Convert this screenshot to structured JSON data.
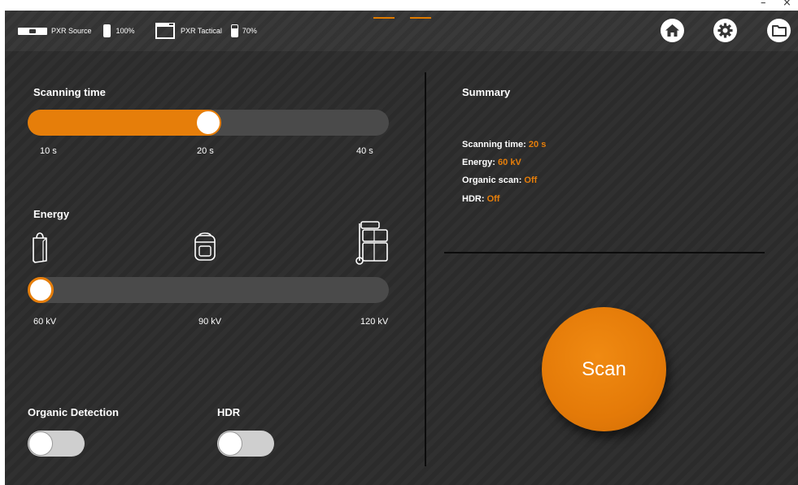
{
  "window": {
    "minimize_glyph": "–",
    "close_glyph": "×"
  },
  "topbar": {
    "devices": [
      {
        "icon": "xray-source-icon",
        "name": "PXR Source",
        "battery_icon": "battery-icon",
        "battery": "100%"
      },
      {
        "icon": "tactical-panel-icon",
        "name": "PXR Tactical",
        "battery_icon": "battery-icon",
        "battery": "70%"
      }
    ],
    "nav": [
      {
        "icon": "home-icon"
      },
      {
        "icon": "gear-icon"
      },
      {
        "icon": "folder-icon"
      }
    ]
  },
  "scanning_time": {
    "label": "Scanning time",
    "ticks": [
      "10 s",
      "20 s",
      "40 s"
    ],
    "selected": "20 s",
    "selected_fraction": 0.5
  },
  "energy": {
    "label": "Energy",
    "icons": [
      "bag-icon",
      "backpack-icon",
      "luggage-cart-icon"
    ],
    "ticks": [
      "60 kV",
      "90 kV",
      "120 kV"
    ],
    "selected": "60 kV",
    "selected_fraction": 0.0
  },
  "toggles": {
    "organic": {
      "label": "Organic Detection",
      "state": "Off"
    },
    "hdr": {
      "label": "HDR",
      "state": "Off"
    }
  },
  "summary": {
    "title": "Summary",
    "lines": [
      {
        "key": "Scanning time:",
        "value": "20 s"
      },
      {
        "key": "Energy:",
        "value": "60 kV"
      },
      {
        "key": "Organic scan:",
        "value": "Off"
      },
      {
        "key": "HDR:",
        "value": "Off"
      }
    ]
  },
  "scan_button": {
    "label": "Scan"
  },
  "colors": {
    "accent": "#e67e0a",
    "background": "#2c2c2c",
    "topbar": "#353535",
    "track": "#4a4a4a"
  }
}
